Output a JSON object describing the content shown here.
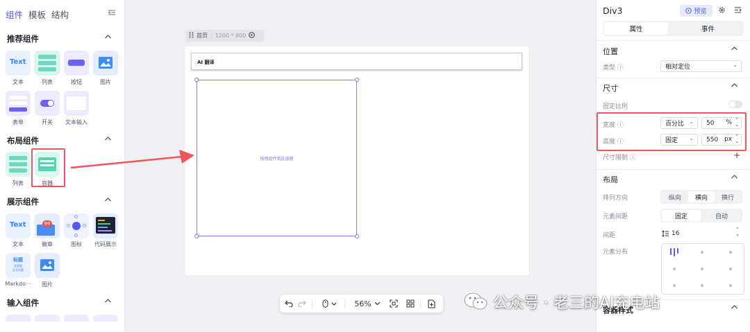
{
  "left_panel": {
    "tabs": [
      "组件",
      "模板",
      "结构"
    ],
    "sections": {
      "recommended": {
        "title": "推荐组件",
        "items": [
          "文本",
          "列表",
          "按钮",
          "图片",
          "表单",
          "开关",
          "文本输入"
        ]
      },
      "layout": {
        "title": "布局组件",
        "items": [
          "列表",
          "容器"
        ]
      },
      "display": {
        "title": "展示组件",
        "items": [
          "文本",
          "徽章",
          "图标",
          "代码展示",
          "Markdo···",
          "图片"
        ]
      },
      "input": {
        "title": "输入组件"
      }
    },
    "thumb_texts": {
      "text_card": "Text",
      "badge_count": "99",
      "md_card_title": "标题",
      "md_card_lines": "这里是\n正文内容"
    }
  },
  "canvas": {
    "frame": {
      "name": "首页",
      "size": "1200 * 800"
    },
    "ai_box_text": "AI 翻译",
    "drop_hint": "拖拽组件到此容器",
    "zoom": "56%"
  },
  "right_panel": {
    "title": "Div3",
    "preview_label": "预览",
    "tabs": {
      "props": "属性",
      "events": "事件"
    },
    "position": {
      "title": "位置",
      "type_label": "类型",
      "type_value": "相对定位"
    },
    "size": {
      "title": "尺寸",
      "fixed_ratio_label": "固定比例",
      "width_label": "宽度",
      "width_mode": "百分比",
      "width_value": "50",
      "width_unit": "%",
      "height_label": "高度",
      "height_mode": "固定",
      "height_value": "550",
      "height_unit": "px",
      "limit_label": "尺寸限制"
    },
    "layout": {
      "title": "布局",
      "direction_label": "排列方向",
      "direction_options": [
        "纵向",
        "横向",
        "换行"
      ],
      "direction_selected": "横向",
      "gap_label": "元素间距",
      "gap_options": [
        "固定",
        "自动"
      ],
      "gap_selected": "固定",
      "spacing_label": "间距",
      "spacing_value": "16",
      "distribution_label": "元素分布"
    },
    "container_style_title": "容器样式"
  },
  "watermark": "公众号 · 老三的AI充电站",
  "colors": {
    "accent": "#4f5bf5",
    "highlight": "#f2545b",
    "selection": "#7f7bf1"
  }
}
